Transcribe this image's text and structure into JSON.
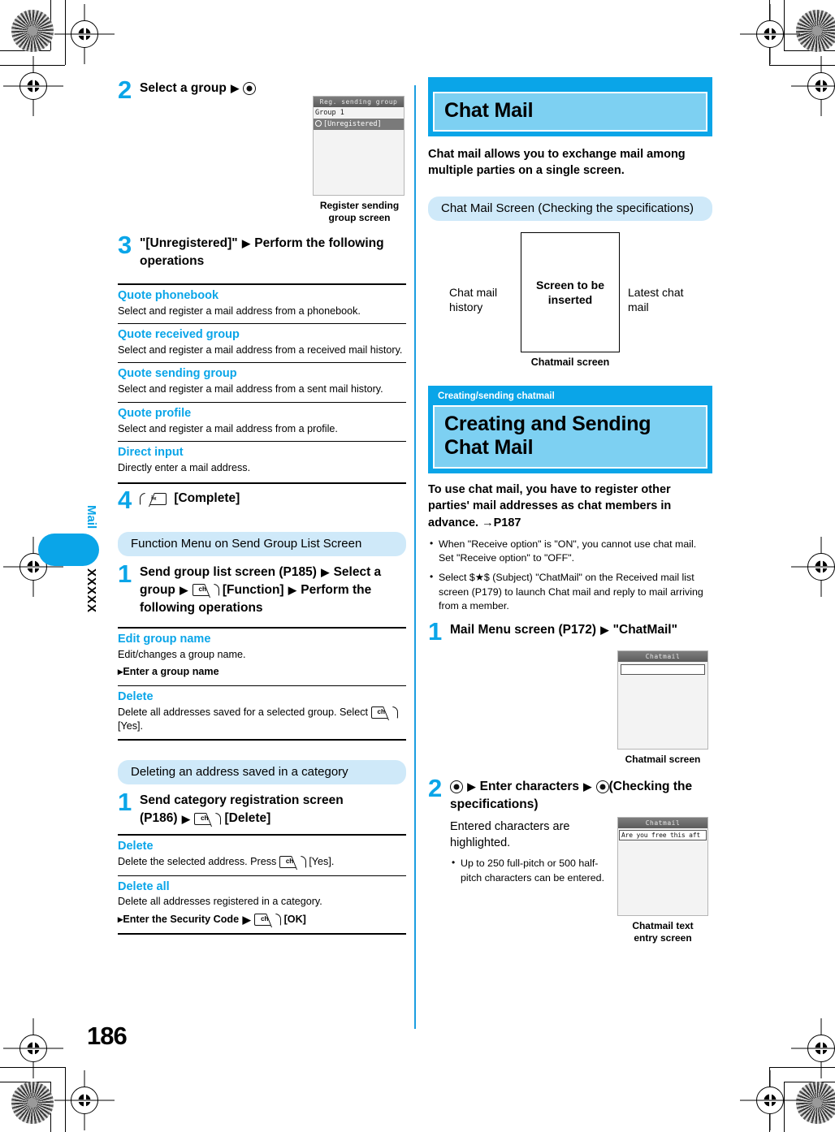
{
  "page": {
    "number": "186",
    "side_tab_label": "Mail",
    "side_tab_code": "XXXXX"
  },
  "left_column": {
    "step2": {
      "number": "2",
      "text_before": "Select a group",
      "icon": "center-select-key"
    },
    "screenshot_reg_group": {
      "title": "Reg. sending group",
      "rows": [
        "Group 1",
        "[Unregistered]"
      ],
      "selected_row_index": 1,
      "caption": "Register sending\ngroup screen",
      "caption_line1": "Register sending",
      "caption_line2": "group screen"
    },
    "step3": {
      "number": "3",
      "line1": "\"[Unregistered]\"",
      "line1b": "Perform the",
      "line2": "following operations"
    },
    "options": [
      {
        "term": "Quote phonebook",
        "desc": "Select and register a mail address from a phonebook."
      },
      {
        "term": "Quote received group",
        "desc": "Select and register a mail address from a received mail history."
      },
      {
        "term": "Quote sending group",
        "desc": "Select and register a mail address from a sent mail history."
      },
      {
        "term": "Quote profile",
        "desc": "Select and register a mail address from a profile."
      },
      {
        "term": "Direct input",
        "desc": "Directly enter a mail address."
      }
    ],
    "step4": {
      "number": "4",
      "key_label": "i«",
      "text": "[Complete]"
    },
    "function_menu": {
      "heading": "Function Menu on Send Group List Screen",
      "step1_number": "1",
      "step1_part1": "Send group list screen (P185)",
      "step1_part2": "Select a group",
      "step1_key": "ch",
      "step1_part3": "[Function]",
      "step1_part4": "Perform the following operations",
      "items": [
        {
          "term": "Edit group name",
          "desc": "Edit/changes a group name.",
          "sub_arrow": "▸",
          "sub": "Enter a group name"
        },
        {
          "term": "Delete",
          "desc_a": "Delete all addresses saved for a selected group. Select",
          "key": "ch",
          "desc_b": "[Yes]."
        }
      ]
    },
    "delete_category": {
      "heading": "Deleting an address saved in a category",
      "step1_number": "1",
      "step1_line1": "Send category registration screen",
      "step1_line2a": "(P186)",
      "step1_key": "ch",
      "step1_line2b": "[Delete]",
      "items": [
        {
          "term": "Delete",
          "desc_a": "Delete the selected address. Press",
          "key": "ch",
          "desc_b": "[Yes]."
        },
        {
          "term": "Delete all",
          "desc": "Delete all addresses registered in a category.",
          "sub_arrow": "▸",
          "sub_a": "Enter the Security Code",
          "sub_key": "ch",
          "sub_b": "[OK]"
        }
      ]
    }
  },
  "right_column": {
    "header1": {
      "title": "Chat Mail"
    },
    "lead1": "Chat mail allows you to exchange mail among multiple parties on a single screen.",
    "pill1": "Chat Mail Screen (Checking the specifications)",
    "diagram": {
      "left_label": "Chat mail history",
      "box_label": "Screen to be inserted",
      "right_label": "Latest chat mail",
      "caption": "Chatmail screen"
    },
    "header2": {
      "kicker": "Creating/sending chatmail",
      "title": "Creating and Sending Chat Mail"
    },
    "lead2": "To use chat mail, you have to register other parties' mail addresses as chat members in advance. →P187",
    "notes": [
      "When \"Receive option\" is \"ON\", you cannot use chat mail. Set \"Receive option\" to \"OFF\".",
      "Select $★$ (Subject) \"ChatMail\" on the Received mail list screen (P179) to launch Chat mail and reply to mail arriving from a member."
    ],
    "step1": {
      "number": "1",
      "text": "Mail Menu screen (P172)",
      "text2": "\"ChatMail\""
    },
    "screenshot_chatmail": {
      "title": "Chatmail",
      "caption": "Chatmail screen"
    },
    "step2": {
      "number": "2",
      "text_a": "Enter characters",
      "text_b": "(Checking the specifications)",
      "body": "Entered characters are highlighted.",
      "notes": [
        "Up to 250 full-pitch or 500 half-pitch characters can be entered."
      ]
    },
    "screenshot_chatmail_text": {
      "title": "Chatmail",
      "field_text": "Are you free this aft",
      "caption_line1": "Chatmail text",
      "caption_line2": "entry screen"
    }
  },
  "colors": {
    "accent_blue": "#0aa5e8",
    "pale_blue": "#cfe9f9",
    "header_inner": "#7dd0f2"
  }
}
